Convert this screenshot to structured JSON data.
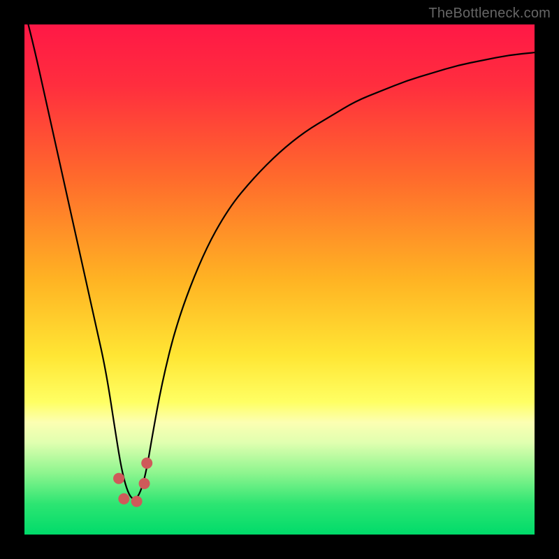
{
  "watermark": "TheBottleneck.com",
  "chart_data": {
    "type": "line",
    "title": "",
    "xlabel": "",
    "ylabel": "",
    "xlim": [
      0,
      100
    ],
    "ylim": [
      0,
      100
    ],
    "grid": false,
    "gradient_stops": [
      {
        "pct": 0,
        "color": "#ff1846"
      },
      {
        "pct": 12,
        "color": "#ff2e3e"
      },
      {
        "pct": 30,
        "color": "#ff6a2c"
      },
      {
        "pct": 50,
        "color": "#ffb323"
      },
      {
        "pct": 65,
        "color": "#ffe634"
      },
      {
        "pct": 74,
        "color": "#ffff63"
      },
      {
        "pct": 78,
        "color": "#fcffb2"
      },
      {
        "pct": 82,
        "color": "#e0ffb0"
      },
      {
        "pct": 88,
        "color": "#8cf58e"
      },
      {
        "pct": 94,
        "color": "#2de572"
      },
      {
        "pct": 100,
        "color": "#00db6a"
      }
    ],
    "series": [
      {
        "name": "bottleneck-curve",
        "type": "line",
        "x": [
          0,
          2,
          4,
          6,
          8,
          10,
          12,
          14,
          16,
          18,
          19,
          20,
          21,
          22,
          23,
          24,
          25,
          27,
          30,
          35,
          40,
          45,
          50,
          55,
          60,
          65,
          70,
          75,
          80,
          85,
          90,
          95,
          100
        ],
        "y": [
          103,
          95,
          86,
          77,
          68,
          59,
          50,
          41,
          32,
          19,
          13,
          9,
          7,
          7,
          9,
          13,
          19,
          30,
          42,
          55,
          64,
          70,
          75,
          79,
          82,
          85,
          87,
          89,
          90.5,
          92,
          93,
          94,
          94.5
        ]
      },
      {
        "name": "red-markers",
        "type": "scatter",
        "x": [
          18.5,
          19.5,
          22.0,
          23.5,
          24.0
        ],
        "y": [
          11,
          7,
          6.5,
          10,
          14
        ],
        "color": "#cf5a5a",
        "size": 16
      }
    ]
  }
}
